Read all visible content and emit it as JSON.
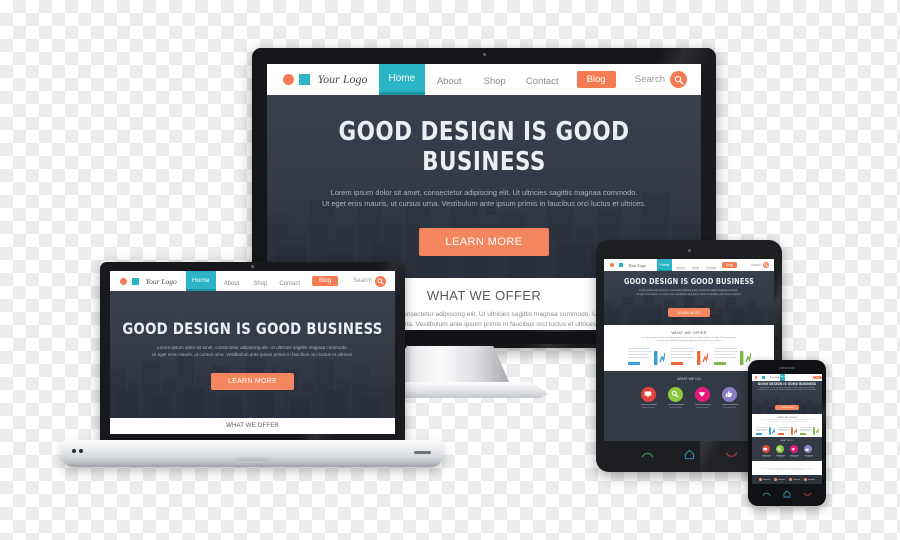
{
  "scene": {
    "title": "Responsive web design device mockup",
    "devices": [
      "desktop-monitor",
      "laptop",
      "tablet",
      "smartphone"
    ],
    "background": "transparent-checkerboard"
  },
  "site": {
    "logo": {
      "text": "Your Logo",
      "dot_color": "#f47b52",
      "square_color": "#2bb3c6"
    },
    "nav": {
      "items": [
        {
          "label": "Home",
          "active": true
        },
        {
          "label": "About",
          "active": false
        },
        {
          "label": "Shop",
          "active": false
        },
        {
          "label": "Contact",
          "active": false
        }
      ],
      "cta": {
        "label": "Blog",
        "color": "#f47b52"
      },
      "search": {
        "label": "Search",
        "icon": "search-icon",
        "color": "#f47b52"
      },
      "active_color": "#2bb3c6"
    },
    "hero": {
      "heading": "GOOD DESIGN IS GOOD BUSINESS",
      "paragraph_line1": "Lorem ipsum dolor sit amet, consectetur adipiscing elit. Ut ultricies sagittis magnaa commodo.",
      "paragraph_line2": "Ut eget eros mauris, ut cursus urna. Vestibulum ante ipsum primis in faucibus orci luctus et ultrices.",
      "button": "LEARN MORE",
      "button_color": "#f4855e",
      "background_color": "#343b47",
      "heading_color": "#eceff2",
      "paragraph_color": "#aab2bd"
    },
    "offer": {
      "heading": "WHAT WE OFFER",
      "paragraph_line1": "Lorem ipsum dolor sit amet, consectetur adipiscing elit. Ut ultricies sagittis magnaa commodo. Ut eget eros mauris,",
      "paragraph_line2": "ut cursus urna. Vestibulum ante ipsum primis in faucibus orci luctus et ultrices.",
      "features": [
        {
          "accent": "#3a9fd8"
        },
        {
          "accent": "#ef6a38"
        },
        {
          "accent": "#7ab648"
        }
      ]
    },
    "work": {
      "heading": "WHAT WE DO",
      "items": [
        {
          "color": "#e0453c",
          "icon": "monitor-icon"
        },
        {
          "color": "#8dc63f",
          "icon": "search-icon"
        },
        {
          "color": "#e6197f",
          "icon": "bird-icon"
        },
        {
          "color": "#8a7fc4",
          "icon": "thumbs-up-icon"
        }
      ]
    }
  },
  "devices": {
    "monitor": {
      "name": "Desktop monitor",
      "bezel_color": "#15161a"
    },
    "laptop": {
      "name": "Laptop",
      "bezel_color": "#18191d",
      "base_color": "#d6d9dd"
    },
    "tablet": {
      "name": "Tablet",
      "bezel_color": "#1d1e22",
      "nav_buttons": [
        {
          "name": "back-button",
          "color": "#3f8f5a"
        },
        {
          "name": "home-button",
          "color": "#2f8fae"
        },
        {
          "name": "recent-button",
          "color": "#a33a3a"
        }
      ]
    },
    "phone": {
      "name": "Smartphone",
      "bezel_color": "#101114",
      "nav_buttons": [
        {
          "name": "call-button",
          "color": "#3f8f5a"
        },
        {
          "name": "home-button",
          "color": "#2f8fae"
        },
        {
          "name": "end-call-button",
          "color": "#a33a3a"
        }
      ]
    }
  }
}
